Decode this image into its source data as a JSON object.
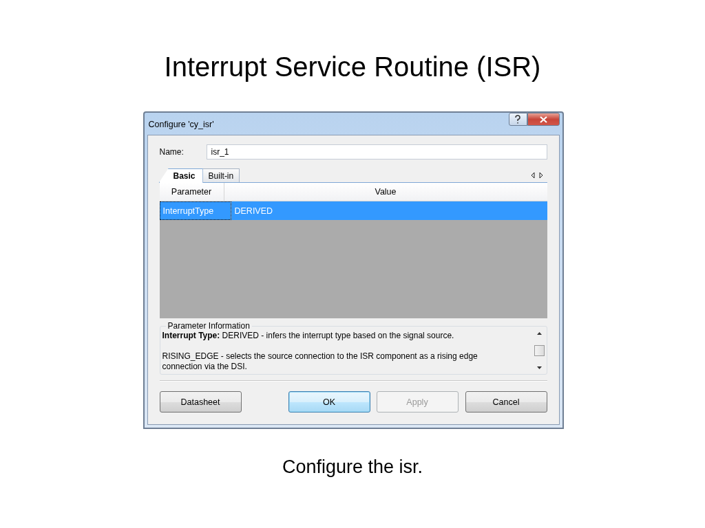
{
  "slide": {
    "title": "Interrupt Service Routine (ISR)",
    "caption": "Configure the isr."
  },
  "dialog": {
    "title": "Configure 'cy_isr'",
    "name_label": "Name:",
    "name_value": "isr_1",
    "tabs": [
      {
        "label": "Basic",
        "selected": true
      },
      {
        "label": "Built-in",
        "selected": false
      }
    ],
    "table": {
      "columns": [
        "Parameter",
        "Value"
      ],
      "rows": [
        {
          "cells": [
            "InterruptType",
            "DERIVED"
          ],
          "selected": true
        }
      ]
    },
    "info": {
      "legend": "Parameter Information",
      "paragraphs": [
        "**Interrupt Type:** DERIVED - infers the interrupt type based on the signal source.",
        "RISING_EDGE - selects the source connection to the ISR component as a rising edge connection via the DSI."
      ]
    },
    "buttons": [
      {
        "label": "Datasheet",
        "kind": "normal"
      },
      {
        "label": "OK",
        "kind": "default"
      },
      {
        "label": "Apply",
        "kind": "disabled"
      },
      {
        "label": "Cancel",
        "kind": "normal"
      }
    ]
  }
}
